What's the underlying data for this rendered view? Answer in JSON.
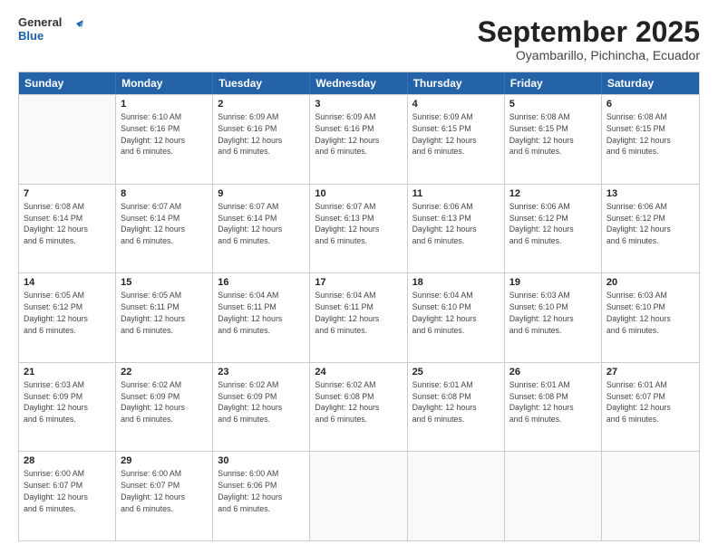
{
  "header": {
    "logo_general": "General",
    "logo_blue": "Blue",
    "month": "September 2025",
    "location": "Oyambarillo, Pichincha, Ecuador"
  },
  "days_of_week": [
    "Sunday",
    "Monday",
    "Tuesday",
    "Wednesday",
    "Thursday",
    "Friday",
    "Saturday"
  ],
  "weeks": [
    [
      {
        "day": "",
        "info": ""
      },
      {
        "day": "1",
        "info": "Sunrise: 6:10 AM\nSunset: 6:16 PM\nDaylight: 12 hours\nand 6 minutes."
      },
      {
        "day": "2",
        "info": "Sunrise: 6:09 AM\nSunset: 6:16 PM\nDaylight: 12 hours\nand 6 minutes."
      },
      {
        "day": "3",
        "info": "Sunrise: 6:09 AM\nSunset: 6:16 PM\nDaylight: 12 hours\nand 6 minutes."
      },
      {
        "day": "4",
        "info": "Sunrise: 6:09 AM\nSunset: 6:15 PM\nDaylight: 12 hours\nand 6 minutes."
      },
      {
        "day": "5",
        "info": "Sunrise: 6:08 AM\nSunset: 6:15 PM\nDaylight: 12 hours\nand 6 minutes."
      },
      {
        "day": "6",
        "info": "Sunrise: 6:08 AM\nSunset: 6:15 PM\nDaylight: 12 hours\nand 6 minutes."
      }
    ],
    [
      {
        "day": "7",
        "info": "Sunrise: 6:08 AM\nSunset: 6:14 PM\nDaylight: 12 hours\nand 6 minutes."
      },
      {
        "day": "8",
        "info": "Sunrise: 6:07 AM\nSunset: 6:14 PM\nDaylight: 12 hours\nand 6 minutes."
      },
      {
        "day": "9",
        "info": "Sunrise: 6:07 AM\nSunset: 6:14 PM\nDaylight: 12 hours\nand 6 minutes."
      },
      {
        "day": "10",
        "info": "Sunrise: 6:07 AM\nSunset: 6:13 PM\nDaylight: 12 hours\nand 6 minutes."
      },
      {
        "day": "11",
        "info": "Sunrise: 6:06 AM\nSunset: 6:13 PM\nDaylight: 12 hours\nand 6 minutes."
      },
      {
        "day": "12",
        "info": "Sunrise: 6:06 AM\nSunset: 6:12 PM\nDaylight: 12 hours\nand 6 minutes."
      },
      {
        "day": "13",
        "info": "Sunrise: 6:06 AM\nSunset: 6:12 PM\nDaylight: 12 hours\nand 6 minutes."
      }
    ],
    [
      {
        "day": "14",
        "info": "Sunrise: 6:05 AM\nSunset: 6:12 PM\nDaylight: 12 hours\nand 6 minutes."
      },
      {
        "day": "15",
        "info": "Sunrise: 6:05 AM\nSunset: 6:11 PM\nDaylight: 12 hours\nand 6 minutes."
      },
      {
        "day": "16",
        "info": "Sunrise: 6:04 AM\nSunset: 6:11 PM\nDaylight: 12 hours\nand 6 minutes."
      },
      {
        "day": "17",
        "info": "Sunrise: 6:04 AM\nSunset: 6:11 PM\nDaylight: 12 hours\nand 6 minutes."
      },
      {
        "day": "18",
        "info": "Sunrise: 6:04 AM\nSunset: 6:10 PM\nDaylight: 12 hours\nand 6 minutes."
      },
      {
        "day": "19",
        "info": "Sunrise: 6:03 AM\nSunset: 6:10 PM\nDaylight: 12 hours\nand 6 minutes."
      },
      {
        "day": "20",
        "info": "Sunrise: 6:03 AM\nSunset: 6:10 PM\nDaylight: 12 hours\nand 6 minutes."
      }
    ],
    [
      {
        "day": "21",
        "info": "Sunrise: 6:03 AM\nSunset: 6:09 PM\nDaylight: 12 hours\nand 6 minutes."
      },
      {
        "day": "22",
        "info": "Sunrise: 6:02 AM\nSunset: 6:09 PM\nDaylight: 12 hours\nand 6 minutes."
      },
      {
        "day": "23",
        "info": "Sunrise: 6:02 AM\nSunset: 6:09 PM\nDaylight: 12 hours\nand 6 minutes."
      },
      {
        "day": "24",
        "info": "Sunrise: 6:02 AM\nSunset: 6:08 PM\nDaylight: 12 hours\nand 6 minutes."
      },
      {
        "day": "25",
        "info": "Sunrise: 6:01 AM\nSunset: 6:08 PM\nDaylight: 12 hours\nand 6 minutes."
      },
      {
        "day": "26",
        "info": "Sunrise: 6:01 AM\nSunset: 6:08 PM\nDaylight: 12 hours\nand 6 minutes."
      },
      {
        "day": "27",
        "info": "Sunrise: 6:01 AM\nSunset: 6:07 PM\nDaylight: 12 hours\nand 6 minutes."
      }
    ],
    [
      {
        "day": "28",
        "info": "Sunrise: 6:00 AM\nSunset: 6:07 PM\nDaylight: 12 hours\nand 6 minutes."
      },
      {
        "day": "29",
        "info": "Sunrise: 6:00 AM\nSunset: 6:07 PM\nDaylight: 12 hours\nand 6 minutes."
      },
      {
        "day": "30",
        "info": "Sunrise: 6:00 AM\nSunset: 6:06 PM\nDaylight: 12 hours\nand 6 minutes."
      },
      {
        "day": "",
        "info": ""
      },
      {
        "day": "",
        "info": ""
      },
      {
        "day": "",
        "info": ""
      },
      {
        "day": "",
        "info": ""
      }
    ]
  ]
}
